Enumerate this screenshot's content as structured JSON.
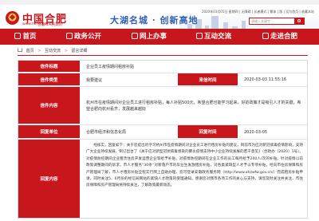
{
  "header": {
    "title": "中国合肥",
    "url": "www.hefei.gov.cn",
    "subtitle": "合肥市人民政府",
    "slogan": "大湖名城 · 创新高地",
    "date": "2020年03月05日 星期四 | 无障碍 | 长者模式 | 繁体 | 版 | 设为首页 | 收藏本站",
    "search_placeholder": "请输入关键字"
  },
  "nav": {
    "items": [
      {
        "label": "首页"
      },
      {
        "label": "政务公开"
      },
      {
        "label": "网上办事"
      },
      {
        "label": "互动交流"
      },
      {
        "label": "走进合肥"
      }
    ]
  },
  "breadcrumb": {
    "items": [
      "首页",
      "互动交流",
      "留言详细"
    ]
  },
  "detail": {
    "labels": {
      "title": "信件标题",
      "category": "信件类型",
      "time": "来信时间",
      "content": "信件内容",
      "unit": "回复单位",
      "reply_time": "回复时间",
      "reply": "回复内容"
    },
    "title": "企业员工疫情期间租房补贴",
    "category": "我要建议",
    "time": "2020-03-03 11:55:16",
    "content": "杭州市在疫情期间对企业员工进行租房补贴，每人补贴500元，希望合肥也能学习起来，好的政策才是吸引人才的关键，希望合肥向杭州看齐，发展越来越好",
    "unit": "合肥市经济和信息化局",
    "reply_time": "2020-03-05",
    "reply": "　　经核实，回复如下：关于您提出的学习杭州市在疫情期间对企业员工进行租房补贴的建议，目前市为应对新冠病毒疫情影响，支持广大企业持续发展，制订出台了《关于应对新型冠状病毒感染的肺炎疫情支持中小企业持续发展的若干意见》（合政办〔2020〕1号）。对疫情防控期间企业租赁住房开发运营企业等给予补贴，对疫情防控期间在企业工作的员工每月给予200人/次的补贴。针对疫情以前政策调整期间的诉求，市人才服务“30条”对新落户市的毕业生发放租房补贴，对各类紧缺型人才予以专项补贴，经向市住房保障和房产管理局了解，市人才租房补贴全程实行网上自助办理，您可登录安徽政务服务网（http://www.ahzwfw.gov.cn/）完成租房补贴申请，同时关注5、6月份的经信局网站的紧缺人才政策的受理通知。感谢您对我市各项工作的关心与支持，请您及时关注并关注，市住房保障和房产管理局将持续关注，了解政策最新动态。"
  },
  "colors": {
    "brand_red": "#c8161d",
    "slogan_blue": "#2f5fb3"
  }
}
